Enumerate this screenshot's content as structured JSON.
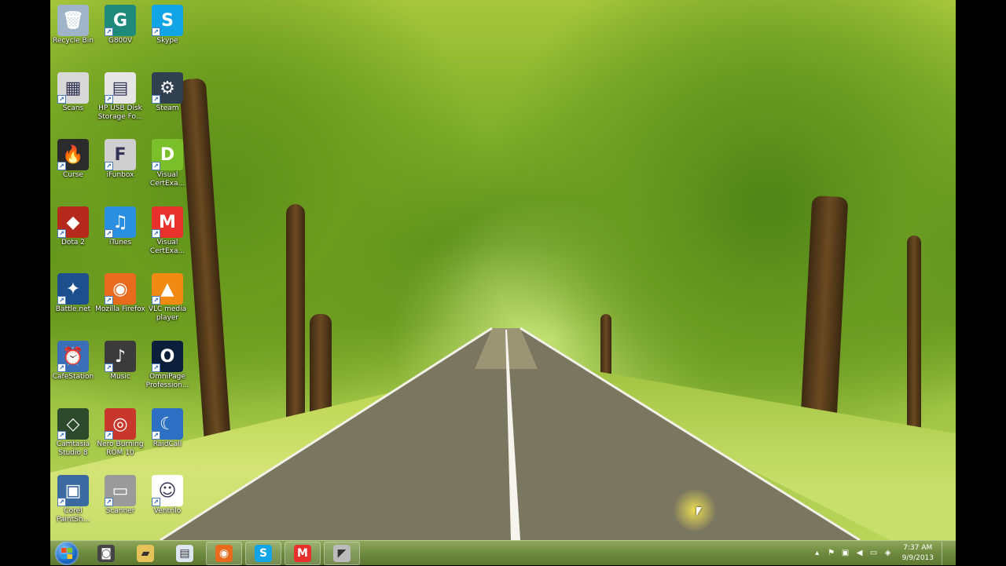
{
  "desktop_icons": [
    {
      "label": "Recycle Bin",
      "icon": "recycle-bin-icon",
      "color": "#9fb4c8",
      "glyph": "🗑"
    },
    {
      "label": "G800V",
      "icon": "g800v-icon",
      "color": "#1f8a7a",
      "glyph": "G"
    },
    {
      "label": "Skype",
      "icon": "skype-icon",
      "color": "#12a5e6",
      "glyph": "S"
    },
    {
      "label": "Scans",
      "icon": "scans-folder-icon",
      "color": "#d8d8d8",
      "glyph": "▦"
    },
    {
      "label": "HP USB Disk Storage Fo...",
      "icon": "hp-usb-icon",
      "color": "#e6e6e6",
      "glyph": "▤"
    },
    {
      "label": "Steam",
      "icon": "steam-icon",
      "color": "#31404f",
      "glyph": "⚙"
    },
    {
      "label": "Curse",
      "icon": "curse-icon",
      "color": "#2b2b2b",
      "glyph": "🔥"
    },
    {
      "label": "iFunbox",
      "icon": "ifunbox-icon",
      "color": "#cfcfcf",
      "glyph": "F"
    },
    {
      "label": "Visual CertExa...",
      "icon": "visual-certexam-designer-icon",
      "color": "#7bbf2a",
      "glyph": "D"
    },
    {
      "label": "Dota 2",
      "icon": "dota2-icon",
      "color": "#b52a1c",
      "glyph": "◆"
    },
    {
      "label": "iTunes",
      "icon": "itunes-icon",
      "color": "#2a8fe0",
      "glyph": "♫"
    },
    {
      "label": "Visual CertExa...",
      "icon": "visual-certexam-manager-icon",
      "color": "#e8302d",
      "glyph": "M"
    },
    {
      "label": "Battle.net",
      "icon": "battlenet-icon",
      "color": "#1d4f8c",
      "glyph": "✦"
    },
    {
      "label": "Mozilla Firefox",
      "icon": "firefox-icon",
      "color": "#e86a1c",
      "glyph": "◉"
    },
    {
      "label": "VLC media player",
      "icon": "vlc-icon",
      "color": "#f08a12",
      "glyph": "▲"
    },
    {
      "label": "CafeStation",
      "icon": "cafestation-icon",
      "color": "#3a6fb8",
      "glyph": "⏰"
    },
    {
      "label": "Music",
      "icon": "music-icon",
      "color": "#3b3b3b",
      "glyph": "♪"
    },
    {
      "label": "OmniPage Profession...",
      "icon": "omnipage-icon",
      "color": "#0c1f3a",
      "glyph": "O"
    },
    {
      "label": "Camtasia Studio 8",
      "icon": "camtasia-icon",
      "color": "#2d4a2d",
      "glyph": "◇"
    },
    {
      "label": "Nero Burning ROM 10",
      "icon": "nero-icon",
      "color": "#c8372b",
      "glyph": "◎"
    },
    {
      "label": "RaidCall",
      "icon": "raidcall-icon",
      "color": "#2d6fc2",
      "glyph": "☾"
    },
    {
      "label": "Corel PaintSh...",
      "icon": "corel-paintshop-icon",
      "color": "#3a6aa0",
      "glyph": "▣"
    },
    {
      "label": "Scanner",
      "icon": "scanner-icon",
      "color": "#9a9a9a",
      "glyph": "▭"
    },
    {
      "label": "Ventrilo",
      "icon": "ventrilo-icon",
      "color": "#ffffff",
      "glyph": "☺"
    }
  ],
  "taskbar": {
    "start_icon": "windows-start-icon",
    "buttons": [
      {
        "name": "taskbar-app-1",
        "icon": "app-icon",
        "glyph": "◙",
        "color": "#444444",
        "pinned": false
      },
      {
        "name": "taskbar-explorer",
        "icon": "folder-icon",
        "glyph": "▰",
        "color": "#e6c25a",
        "pinned": false
      },
      {
        "name": "taskbar-notepad",
        "icon": "document-icon",
        "glyph": "▤",
        "color": "#dde6f0",
        "pinned": false
      },
      {
        "name": "taskbar-firefox",
        "icon": "firefox-icon",
        "glyph": "◉",
        "color": "#e86a1c",
        "pinned": true
      },
      {
        "name": "taskbar-skype",
        "icon": "skype-icon",
        "glyph": "S",
        "color": "#12a5e6",
        "pinned": true
      },
      {
        "name": "taskbar-certexam",
        "icon": "visual-certexam-manager-icon",
        "glyph": "M",
        "color": "#e8302d",
        "pinned": true
      },
      {
        "name": "taskbar-app-7",
        "icon": "app-icon",
        "glyph": "◤",
        "color": "#bbbbbb",
        "pinned": true
      }
    ]
  },
  "tray": {
    "icons": [
      "show-hidden-icon",
      "flag-icon",
      "network-icon",
      "volume-icon",
      "battery-icon",
      "security-icon"
    ],
    "time": "7:37 AM",
    "date": "9/9/2013"
  }
}
